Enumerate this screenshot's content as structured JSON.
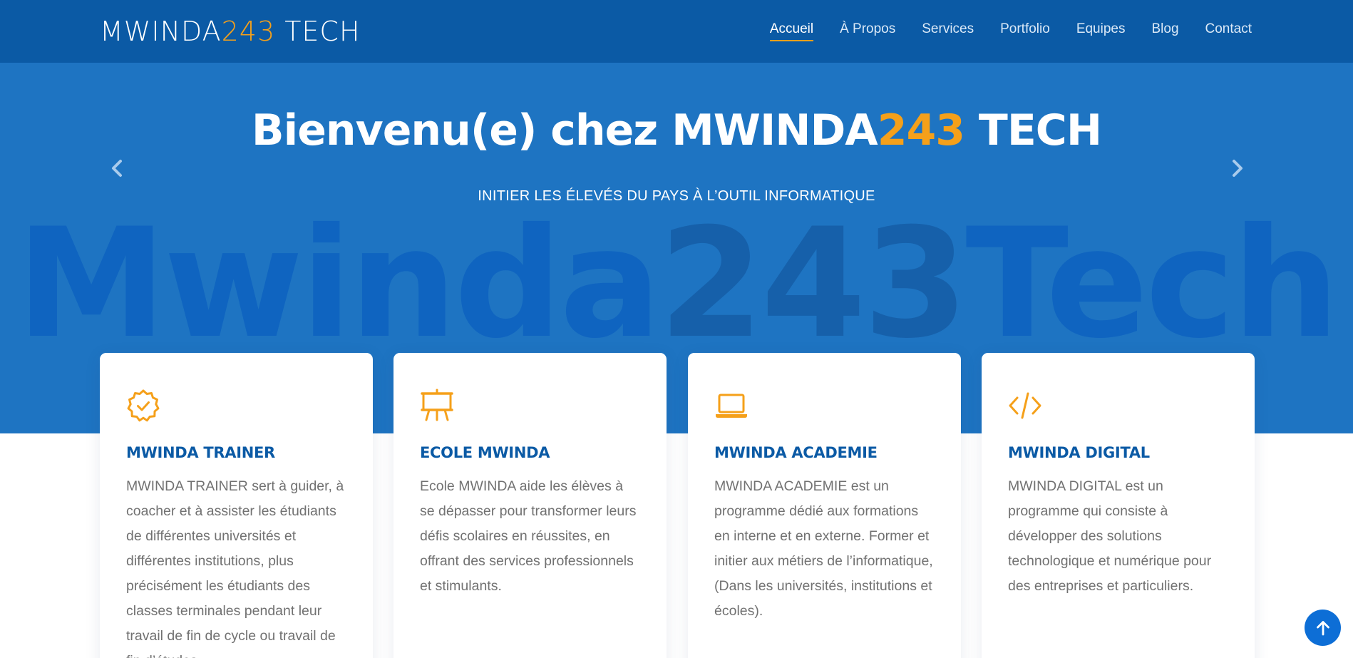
{
  "header": {
    "logo": {
      "part1": "MWINDA",
      "part2": "243",
      "part3": " TECH"
    },
    "nav": [
      {
        "label": "Accueil",
        "active": true
      },
      {
        "label": "À Propos"
      },
      {
        "label": "Services"
      },
      {
        "label": "Portfolio"
      },
      {
        "label": "Equipes"
      },
      {
        "label": "Blog"
      },
      {
        "label": "Contact"
      }
    ]
  },
  "hero": {
    "title": {
      "part1": "Bienvenu(e) chez MWINDA",
      "part2": "243",
      "part3": " TECH"
    },
    "subtitle": "INITIER LES ÉLEVÉS DU PAYS À L’OUTIL INFORMATIQUE",
    "watermark": {
      "part1": "Mwinda",
      "part2": "243",
      "part3": "Tech"
    },
    "prev_icon": "chevron-left-icon",
    "next_icon": "chevron-right-icon"
  },
  "cards": [
    {
      "icon": "badge-check-icon",
      "title": "MWINDA TRAINER",
      "text": "MWINDA TRAINER sert à guider, à coacher et à assister les étudiants de différentes universités et différentes institutions, plus précisément les étudiants des classes terminales pendant leur travail de fin de cycle ou travail de fin d’études."
    },
    {
      "icon": "easel-icon",
      "title": "ECOLE MWINDA",
      "text": "Ecole MWINDA aide les élèves à se dépasser pour transformer leurs défis scolaires en réussites, en offrant des services professionnels et stimulants."
    },
    {
      "icon": "laptop-icon",
      "title": "MWINDA ACADEMIE",
      "text": "MWINDA ACADEMIE est un programme dédié aux formations en interne et en externe. Former et initier aux métiers de l’informatique, (Dans les universités, institutions et écoles)."
    },
    {
      "icon": "code-icon",
      "title": "MWINDA DIGITAL",
      "text": "MWINDA DIGITAL est un programme qui consiste à développer des solutions technologique et numérique pour des entreprises et particuliers."
    }
  ],
  "back_to_top_icon": "arrow-up-icon",
  "colors": {
    "header_bg": "#0b5aa5",
    "hero_bg": "#1e74c2",
    "accent": "#f5a01a",
    "card_title": "#0b5aa5",
    "button": "#0d6ed6"
  }
}
